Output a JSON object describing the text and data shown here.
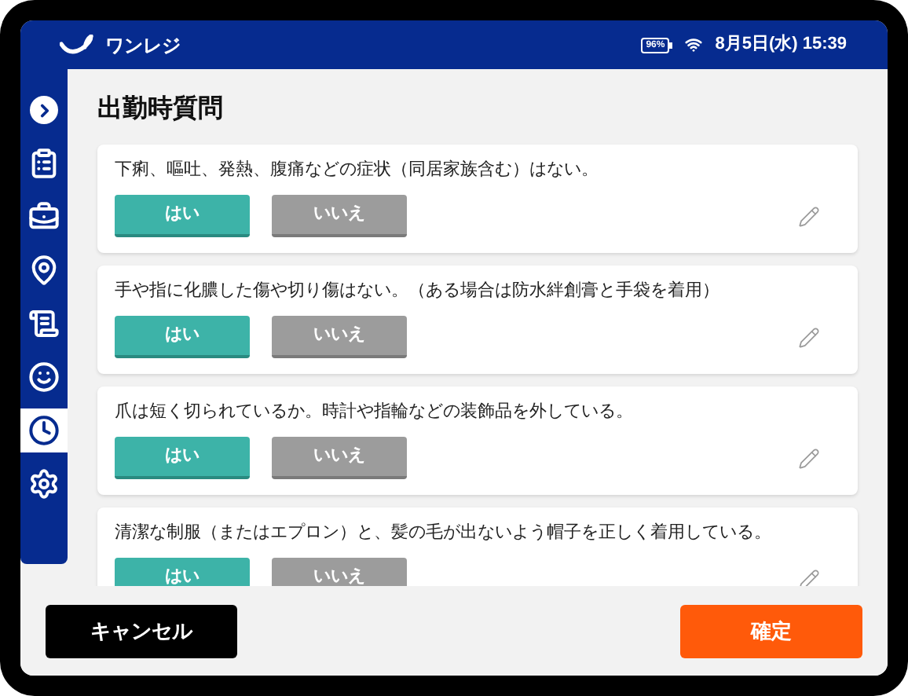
{
  "header": {
    "logo_text": "ワンレジ",
    "battery": "96%",
    "date_time": "8月5日(水) 15:39"
  },
  "sidebar": {
    "items": [
      {
        "kind": "toggle",
        "selected": false
      },
      {
        "kind": "clipboard",
        "selected": false
      },
      {
        "kind": "register",
        "selected": false
      },
      {
        "kind": "pin",
        "selected": false
      },
      {
        "kind": "receipt",
        "selected": false
      },
      {
        "kind": "round",
        "selected": false
      },
      {
        "kind": "clock",
        "selected": true
      },
      {
        "kind": "gear",
        "selected": false
      }
    ]
  },
  "title": "出勤時質問",
  "questions": [
    {
      "text": "下痢、嘔吐、発熱、腹痛などの症状（同居家族含む）はない。",
      "answers": [
        {
          "label": "はい",
          "selected": true
        },
        {
          "label": "いいえ",
          "selected": false
        }
      ]
    },
    {
      "text": "手や指に化膿した傷や切り傷はない。（ある場合は防水絆創膏と手袋を着用）",
      "answers": [
        {
          "label": "はい",
          "selected": true
        },
        {
          "label": "いいえ",
          "selected": false
        }
      ]
    },
    {
      "text": "爪は短く切られているか。時計や指輪などの装飾品を外している。",
      "answers": [
        {
          "label": "はい",
          "selected": true
        },
        {
          "label": "いいえ",
          "selected": false
        }
      ]
    },
    {
      "text": "清潔な制服（またはエプロン）と、髪の毛が出ないよう帽子を正しく着用している。",
      "answers": [
        {
          "label": "はい",
          "selected": true
        },
        {
          "label": "いいえ",
          "selected": false
        }
      ]
    }
  ],
  "footer": {
    "cancel": "キャンセル",
    "confirm": "確定"
  }
}
